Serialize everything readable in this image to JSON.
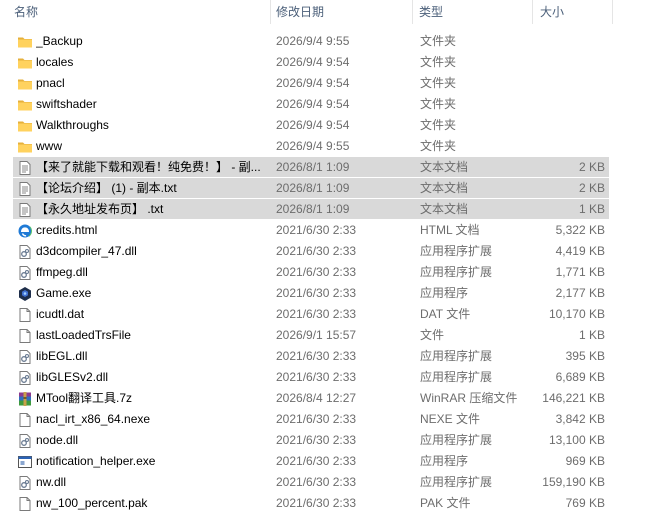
{
  "columns": {
    "name": "名称",
    "date": "修改日期",
    "type": "类型",
    "size": "大小"
  },
  "files": [
    {
      "name": "_Backup",
      "date": "2026/9/4 9:55",
      "type": "文件夹",
      "size": "",
      "icon": "folder-icon",
      "selected": false
    },
    {
      "name": "locales",
      "date": "2026/9/4 9:54",
      "type": "文件夹",
      "size": "",
      "icon": "folder-icon",
      "selected": false
    },
    {
      "name": "pnacl",
      "date": "2026/9/4 9:54",
      "type": "文件夹",
      "size": "",
      "icon": "folder-icon",
      "selected": false
    },
    {
      "name": "swiftshader",
      "date": "2026/9/4 9:54",
      "type": "文件夹",
      "size": "",
      "icon": "folder-icon",
      "selected": false
    },
    {
      "name": "Walkthroughs",
      "date": "2026/9/4 9:54",
      "type": "文件夹",
      "size": "",
      "icon": "folder-icon",
      "selected": false
    },
    {
      "name": "www",
      "date": "2026/9/4 9:55",
      "type": "文件夹",
      "size": "",
      "icon": "folder-icon",
      "selected": false
    },
    {
      "name": "【来了就能下载和观看！纯免费！】 - 副...",
      "date": "2026/8/1 1:09",
      "type": "文本文档",
      "size": "2 KB",
      "icon": "text-file-icon",
      "selected": true
    },
    {
      "name": "【论坛介绍】 (1) - 副本.txt",
      "date": "2026/8/1 1:09",
      "type": "文本文档",
      "size": "2 KB",
      "icon": "text-file-icon",
      "selected": true
    },
    {
      "name": "【永久地址发布页】 .txt",
      "date": "2026/8/1 1:09",
      "type": "文本文档",
      "size": "1 KB",
      "icon": "text-file-icon",
      "selected": true
    },
    {
      "name": "credits.html",
      "date": "2021/6/30 2:33",
      "type": "HTML 文档",
      "size": "5,322 KB",
      "icon": "edge-html-icon",
      "selected": false
    },
    {
      "name": "d3dcompiler_47.dll",
      "date": "2021/6/30 2:33",
      "type": "应用程序扩展",
      "size": "4,419 KB",
      "icon": "dll-file-icon",
      "selected": false
    },
    {
      "name": "ffmpeg.dll",
      "date": "2021/6/30 2:33",
      "type": "应用程序扩展",
      "size": "1,771 KB",
      "icon": "dll-file-icon",
      "selected": false
    },
    {
      "name": "Game.exe",
      "date": "2021/6/30 2:33",
      "type": "应用程序",
      "size": "2,177 KB",
      "icon": "game-exe-icon",
      "selected": false
    },
    {
      "name": "icudtl.dat",
      "date": "2021/6/30 2:33",
      "type": "DAT 文件",
      "size": "10,170 KB",
      "icon": "blank-file-icon",
      "selected": false
    },
    {
      "name": "lastLoadedTrsFile",
      "date": "2026/9/1 15:57",
      "type": "文件",
      "size": "1 KB",
      "icon": "blank-file-icon",
      "selected": false
    },
    {
      "name": "libEGL.dll",
      "date": "2021/6/30 2:33",
      "type": "应用程序扩展",
      "size": "395 KB",
      "icon": "dll-file-icon",
      "selected": false
    },
    {
      "name": "libGLESv2.dll",
      "date": "2021/6/30 2:33",
      "type": "应用程序扩展",
      "size": "6,689 KB",
      "icon": "dll-file-icon",
      "selected": false
    },
    {
      "name": "MTool翻译工具.7z",
      "date": "2026/8/4 12:27",
      "type": "WinRAR 压缩文件",
      "size": "146,221 KB",
      "icon": "winrar-archive-icon",
      "selected": false
    },
    {
      "name": "nacl_irt_x86_64.nexe",
      "date": "2021/6/30 2:33",
      "type": "NEXE 文件",
      "size": "3,842 KB",
      "icon": "blank-file-icon",
      "selected": false
    },
    {
      "name": "node.dll",
      "date": "2021/6/30 2:33",
      "type": "应用程序扩展",
      "size": "13,100 KB",
      "icon": "dll-file-icon",
      "selected": false
    },
    {
      "name": "notification_helper.exe",
      "date": "2021/6/30 2:33",
      "type": "应用程序",
      "size": "969 KB",
      "icon": "exe-window-icon",
      "selected": false
    },
    {
      "name": "nw.dll",
      "date": "2021/6/30 2:33",
      "type": "应用程序扩展",
      "size": "159,190 KB",
      "icon": "dll-file-icon",
      "selected": false
    },
    {
      "name": "nw_100_percent.pak",
      "date": "2021/6/30 2:33",
      "type": "PAK 文件",
      "size": "769 KB",
      "icon": "blank-file-icon",
      "selected": false
    }
  ]
}
